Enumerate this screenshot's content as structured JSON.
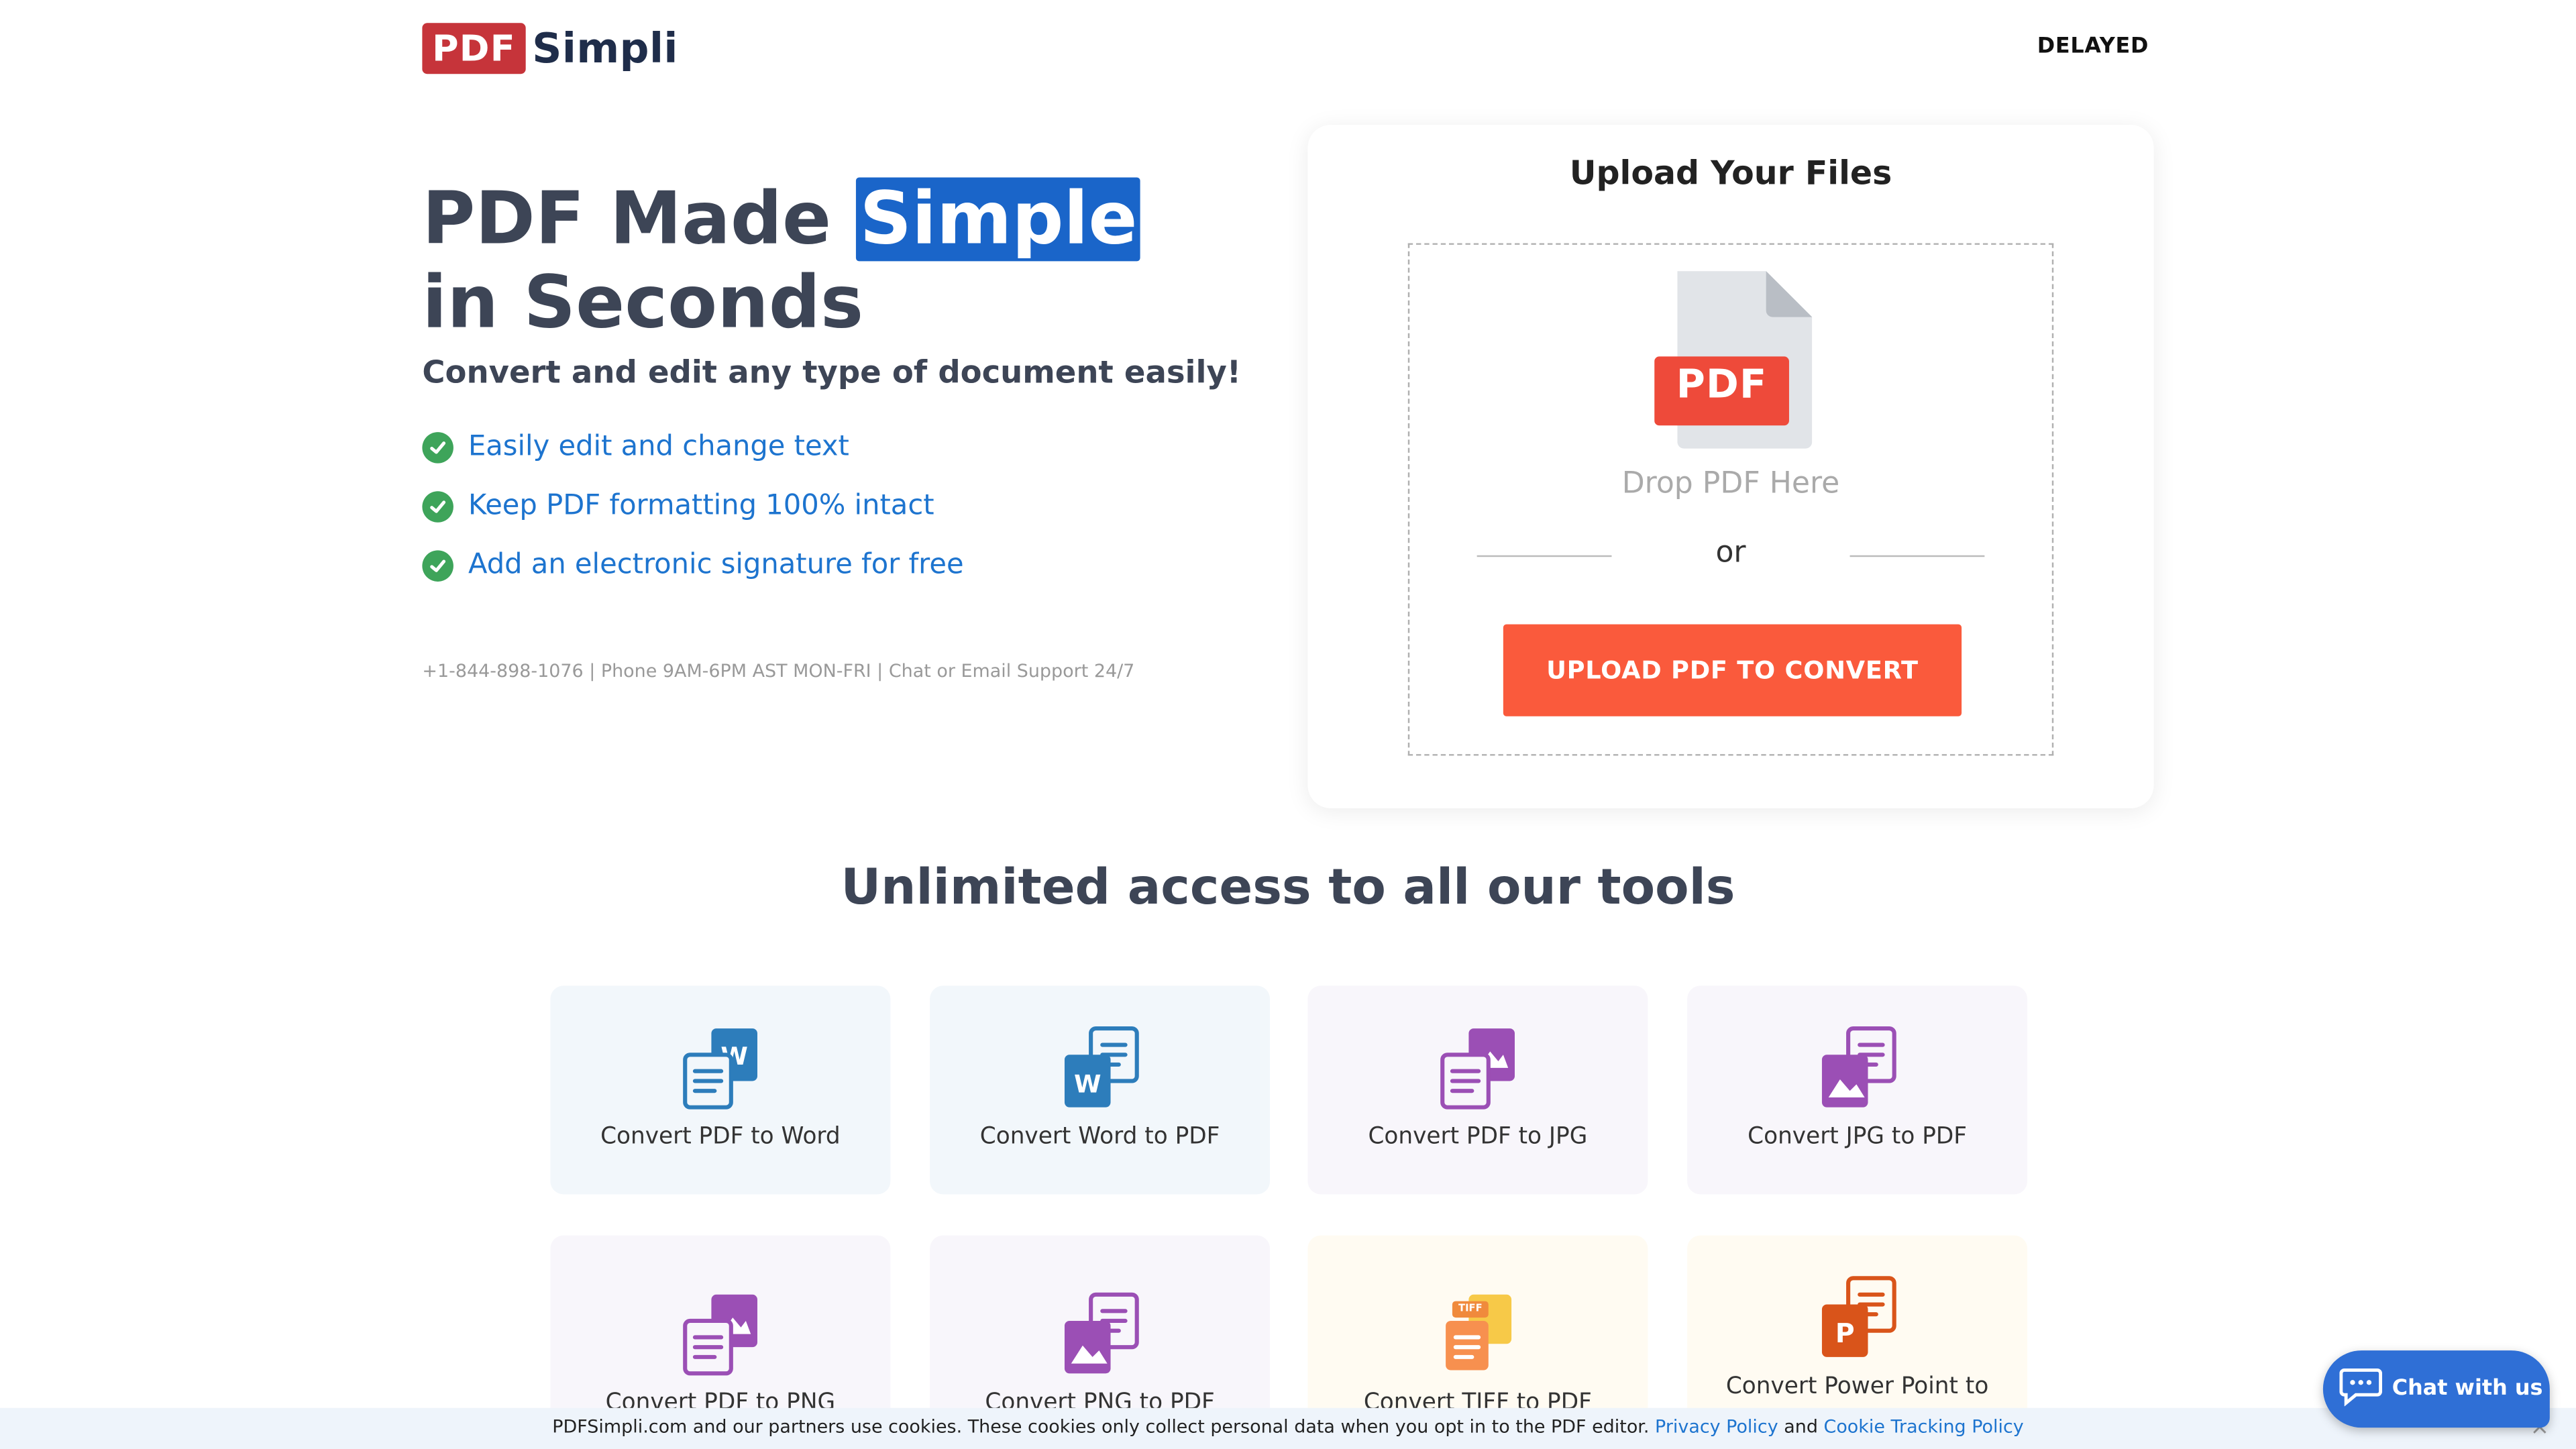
{
  "header": {
    "logo_box": "PDF",
    "logo_text": "Simpli",
    "status": "DELAYED"
  },
  "hero": {
    "title_part1": "PDF Made ",
    "title_highlight": "Simple",
    "title_part2": "in Seconds",
    "subtitle": "Convert and edit any type of document easily!",
    "features": [
      "Easily edit and change text",
      "Keep PDF formatting 100% intact",
      "Add an electronic signature for free"
    ],
    "contact": "+1-844-898-1076 | Phone 9AM-6PM AST MON-FRI | Chat or Email Support 24/7"
  },
  "upload": {
    "title": "Upload Your Files",
    "file_badge": "PDF",
    "drop_text": "Drop PDF Here",
    "or": "or",
    "button": "UPLOAD PDF TO CONVERT"
  },
  "tools": {
    "title": "Unlimited access to all our tools",
    "items": [
      {
        "label": "Convert PDF to Word",
        "icon": "pdf-to-word-icon"
      },
      {
        "label": "Convert Word to PDF",
        "icon": "word-to-pdf-icon"
      },
      {
        "label": "Convert PDF to JPG",
        "icon": "pdf-to-jpg-icon"
      },
      {
        "label": "Convert JPG to PDF",
        "icon": "jpg-to-pdf-icon"
      },
      {
        "label": "Convert PDF to PNG",
        "icon": "pdf-to-png-icon"
      },
      {
        "label": "Convert PNG to PDF",
        "icon": "png-to-pdf-icon"
      },
      {
        "label": "Convert TIFF to PDF",
        "icon": "tiff-to-pdf-icon",
        "icon_badge": "TIFF"
      },
      {
        "label": "Convert Power Point to",
        "icon": "powerpoint-to-pdf-icon",
        "icon_letter": "P"
      }
    ]
  },
  "cookie": {
    "text": "PDFSimpli.com and our partners use cookies. These cookies only collect personal data when you opt in to the PDF editor.",
    "privacy_link": "Privacy Policy",
    "and": "and",
    "cookie_link": "Cookie Tracking Policy",
    "close": "×"
  },
  "chat": {
    "label": "Chat with us"
  },
  "colors": {
    "brand_red": "#c6343a",
    "highlight_blue": "#1a65c9",
    "cta_orange": "#fa5a3c",
    "link_blue": "#1d74cf",
    "check_green": "#3ea45a"
  }
}
